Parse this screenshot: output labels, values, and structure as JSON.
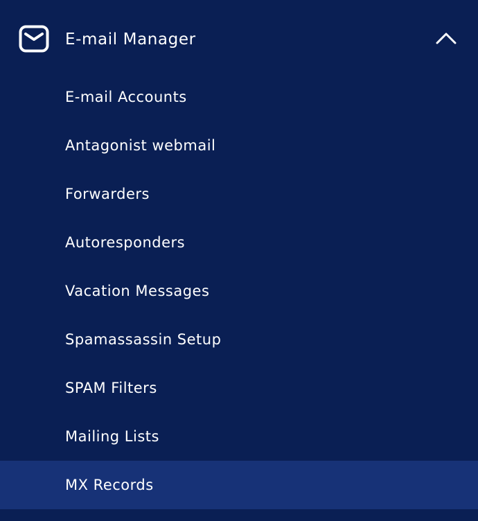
{
  "menu": {
    "title": "E-mail Manager",
    "header_icon": "mail-icon",
    "toggle_icon": "chevron-up-icon",
    "expanded": true,
    "active_index": 8,
    "colors": {
      "background": "#0a1f54",
      "active_background": "#173277",
      "text": "#ffffff"
    },
    "items": [
      {
        "label": "E-mail Accounts"
      },
      {
        "label": "Antagonist webmail"
      },
      {
        "label": "Forwarders"
      },
      {
        "label": "Autoresponders"
      },
      {
        "label": "Vacation Messages"
      },
      {
        "label": "Spamassassin Setup"
      },
      {
        "label": "SPAM Filters"
      },
      {
        "label": "Mailing Lists"
      },
      {
        "label": "MX Records"
      }
    ]
  }
}
